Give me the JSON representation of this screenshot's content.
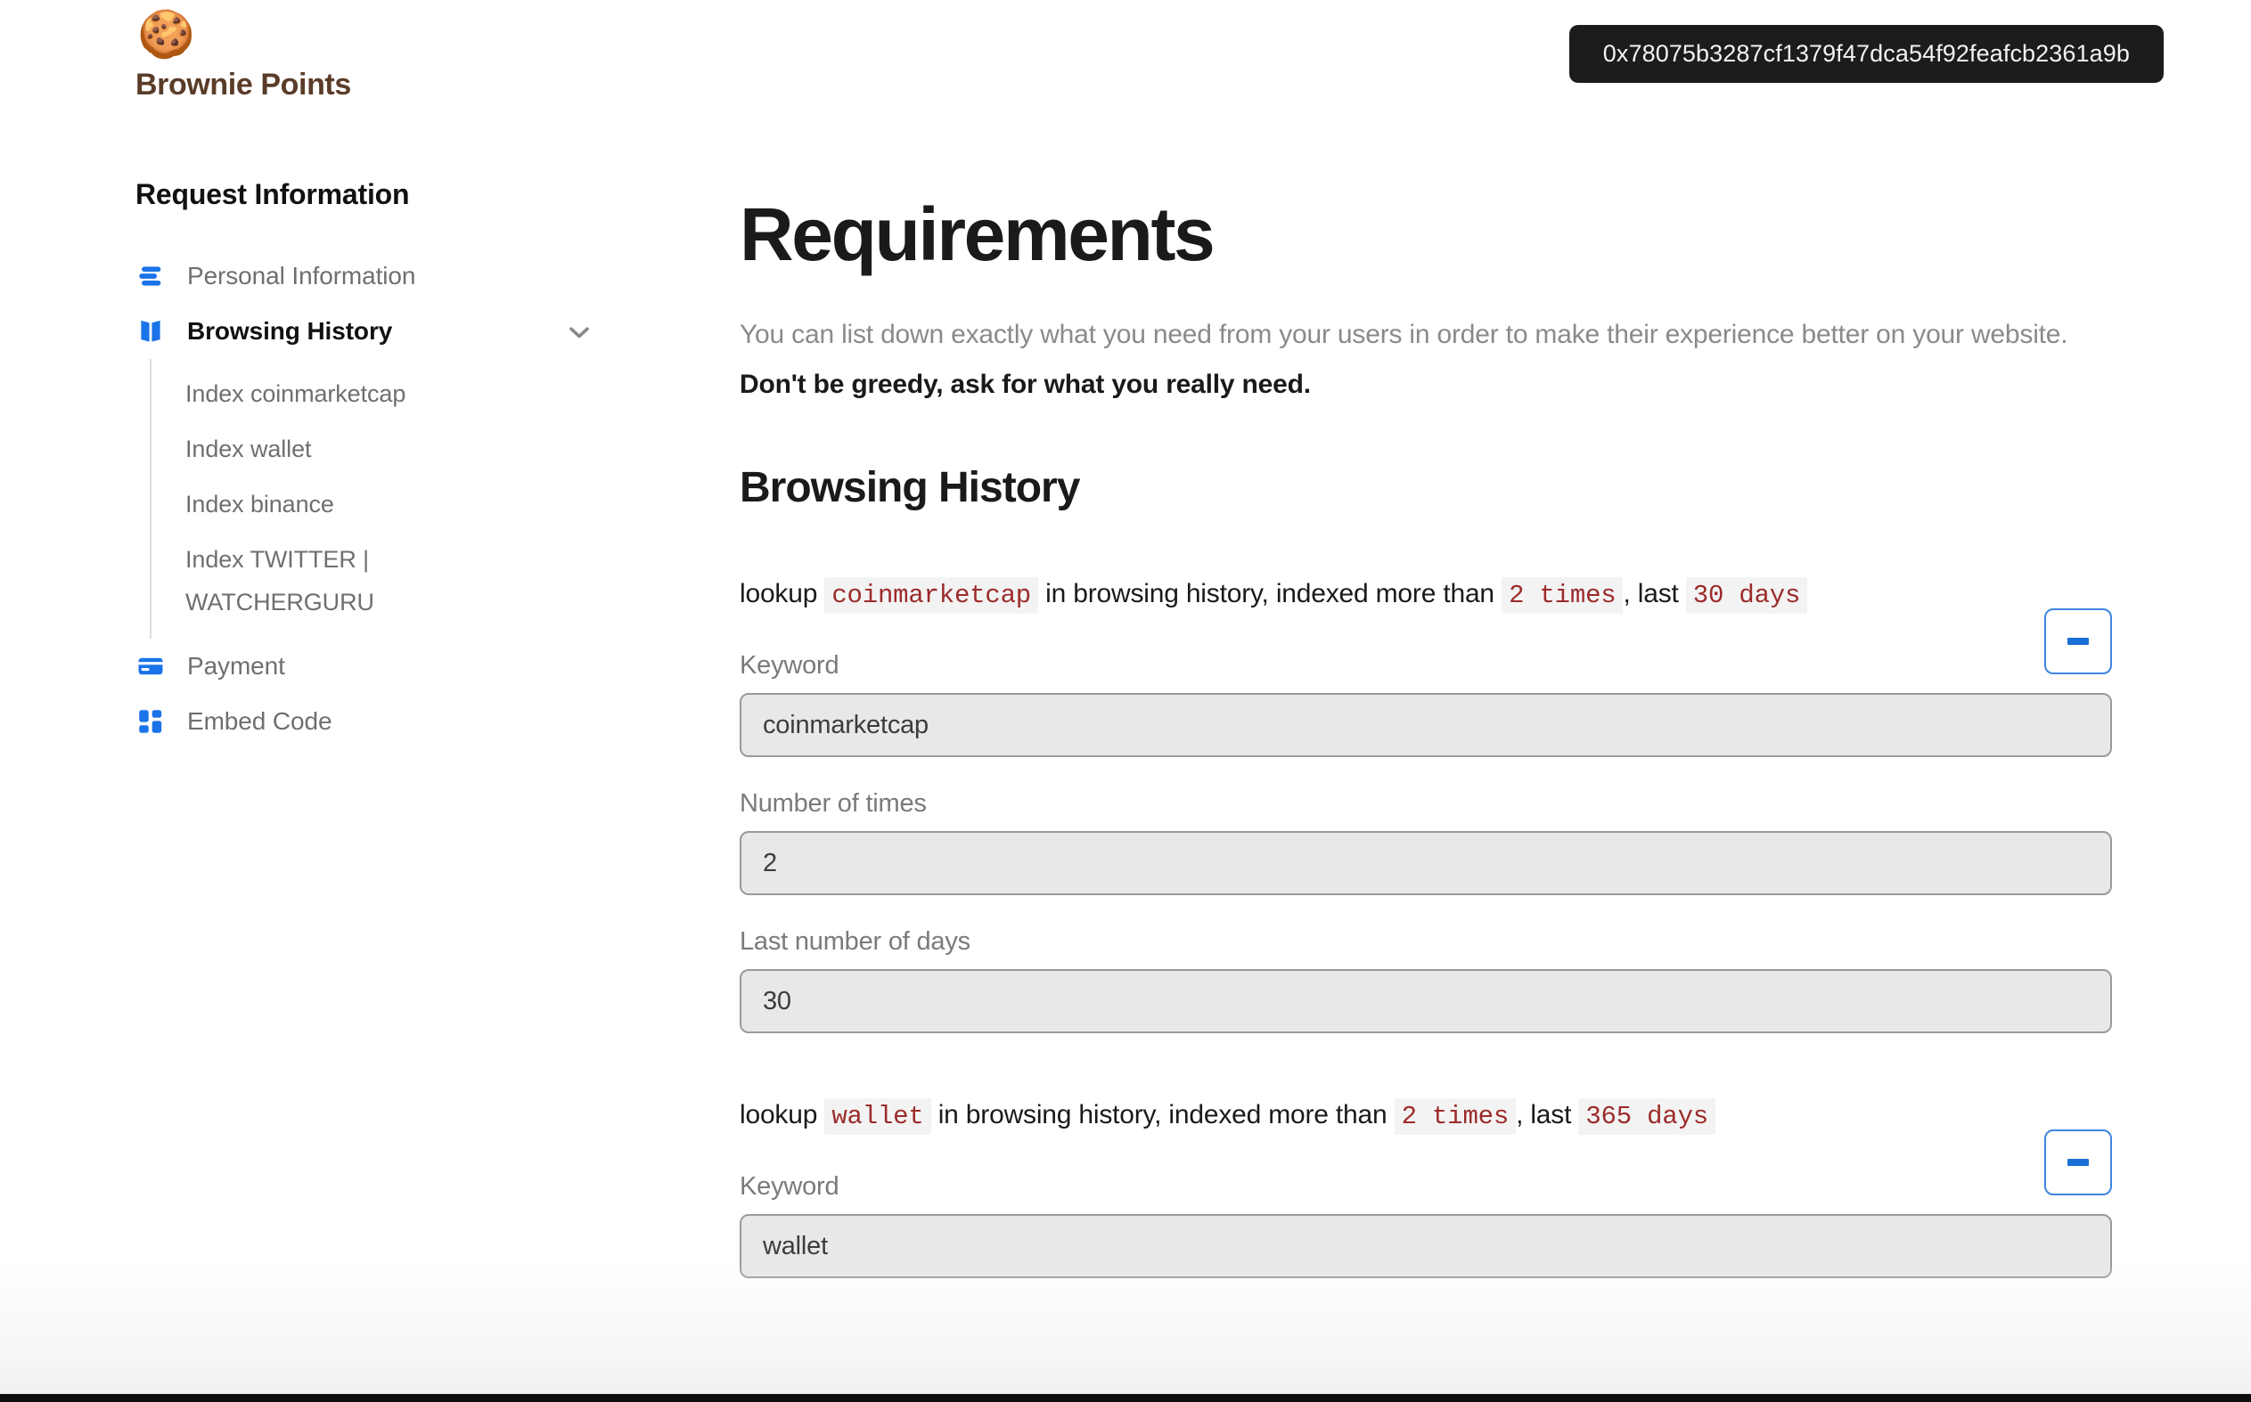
{
  "brand": {
    "logo_icon": "cookie-icon",
    "logo_glyph": "🍪",
    "name": "Brownie Points",
    "name_color": "#5a3c28"
  },
  "header": {
    "wallet_address": "0x78075b3287cf1379f47dca54f92feafcb2361a9b",
    "wallet_badge_bg": "#1c1c1c"
  },
  "sidebar": {
    "title": "Request Information",
    "accent_color": "#1a73e8",
    "items": [
      {
        "label": "Personal Information",
        "icon": "list-lines-icon",
        "active": false
      },
      {
        "label": "Browsing History",
        "icon": "open-book-icon",
        "active": true,
        "expanded": true,
        "chevron": "chevron-down-icon"
      },
      {
        "label": "Payment",
        "icon": "credit-card-icon",
        "active": false
      },
      {
        "label": "Embed Code",
        "icon": "grid-blocks-icon",
        "active": false
      }
    ],
    "subitems": [
      {
        "label": "Index coinmarketcap"
      },
      {
        "label": "Index wallet"
      },
      {
        "label": "Index binance"
      },
      {
        "label": "Index TWITTER | WATCHERGURU"
      }
    ]
  },
  "main": {
    "page_title": "Requirements",
    "intro_normal": "You can list down exactly what you need from your users in order to make their experience better on your website. ",
    "intro_bold": "Don't be greedy, ask for what you really need.",
    "section_title": "Browsing History",
    "rules": [
      {
        "prefix": "lookup",
        "keyword_chip": "coinmarketcap",
        "middle": "in browsing history, indexed more than",
        "times_chip": "2 times",
        "separator": ", last",
        "days_chip": "30 days",
        "remove_label": "-",
        "fields": [
          {
            "label": "Keyword",
            "value": "coinmarketcap"
          },
          {
            "label": "Number of times",
            "value": "2"
          },
          {
            "label": "Last number of days",
            "value": "30"
          }
        ]
      },
      {
        "prefix": "lookup",
        "keyword_chip": "wallet",
        "middle": "in browsing history, indexed more than",
        "times_chip": "2 times",
        "separator": ", last",
        "days_chip": "365 days",
        "remove_label": "-",
        "fields": [
          {
            "label": "Keyword",
            "value": "wallet"
          }
        ]
      }
    ]
  },
  "colors": {
    "chip_bg": "#f3f3f3",
    "chip_text": "#9c2b2b",
    "input_bg": "#e8e8e8",
    "button_border": "#3f85e0"
  }
}
